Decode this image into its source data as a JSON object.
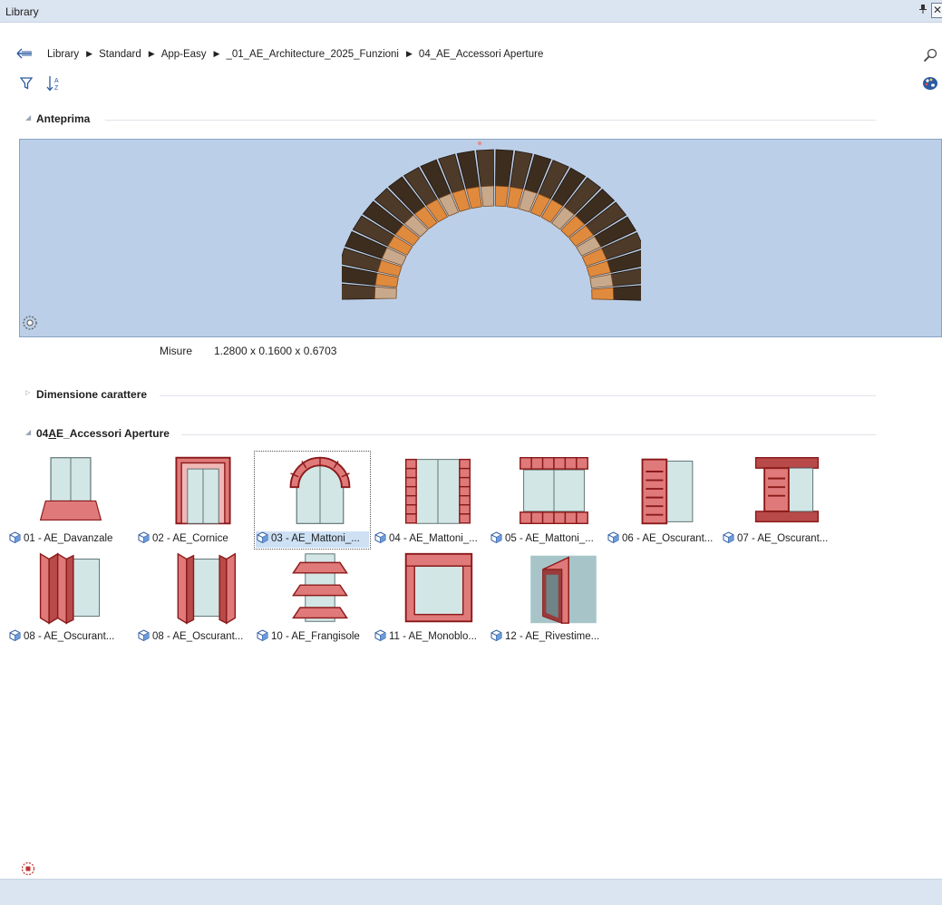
{
  "window": {
    "title": "Library",
    "pin_glyph": "Ͱ",
    "close_glyph": "✕"
  },
  "breadcrumb": {
    "back_icon": "back-arrow-icon",
    "items": [
      "Library",
      "Standard",
      "App-Easy",
      "_01_AE_Architecture_2025_Funzioni",
      "04_AE_Accessori Aperture"
    ],
    "separator": "▶",
    "search_icon": "search-icon"
  },
  "toolbar": {
    "filter_icon": "filter-icon",
    "sort_icon": "sort-az-icon",
    "palette_icon": "palette-icon"
  },
  "sections": {
    "preview": {
      "title": "Anteprima"
    },
    "font_size": {
      "title": "Dimensione carattere"
    },
    "folder": {
      "title_prefix": "04",
      "title_underlined": "A",
      "title_rest": "E_Accessori Aperture"
    }
  },
  "preview": {
    "dims_label": "Misure",
    "dims_value": "1.2800 x 0.1600 x 0.6703",
    "colors": {
      "background": "#bccfe8",
      "brick_dark": "#4e3a28",
      "brick_light": "#e08a3e"
    }
  },
  "items": [
    {
      "label": "01 - AE_Davanzale",
      "icon": "sill-icon"
    },
    {
      "label": "02 - AE_Cornice",
      "icon": "frame-icon"
    },
    {
      "label": "03 - AE_Mattoni_...",
      "icon": "brick-arch-icon",
      "selected": true
    },
    {
      "label": "04 - AE_Mattoni_...",
      "icon": "brick-jamb-icon"
    },
    {
      "label": "05 - AE_Mattoni_...",
      "icon": "brick-lintel-icon"
    },
    {
      "label": "06 - AE_Oscurant...",
      "icon": "shutter-side-icon"
    },
    {
      "label": "07 - AE_Oscurant...",
      "icon": "shutter-box-icon"
    },
    {
      "label": "08 - AE_Oscurant...",
      "icon": "folding-shutter-icon"
    },
    {
      "label": "08 - AE_Oscurant...",
      "icon": "folding-shutter-2-icon"
    },
    {
      "label": "10 - AE_Frangisole",
      "icon": "sunshade-icon"
    },
    {
      "label": "11 - AE_Monoblo...",
      "icon": "monoblock-icon"
    },
    {
      "label": "12 - AE_Rivestime...",
      "icon": "cladding-icon"
    }
  ],
  "colors": {
    "accent_red": "#c0504d",
    "dark_red": "#8b1a1a",
    "glass": "#d3e6e6",
    "selection": "#cde0f4"
  }
}
